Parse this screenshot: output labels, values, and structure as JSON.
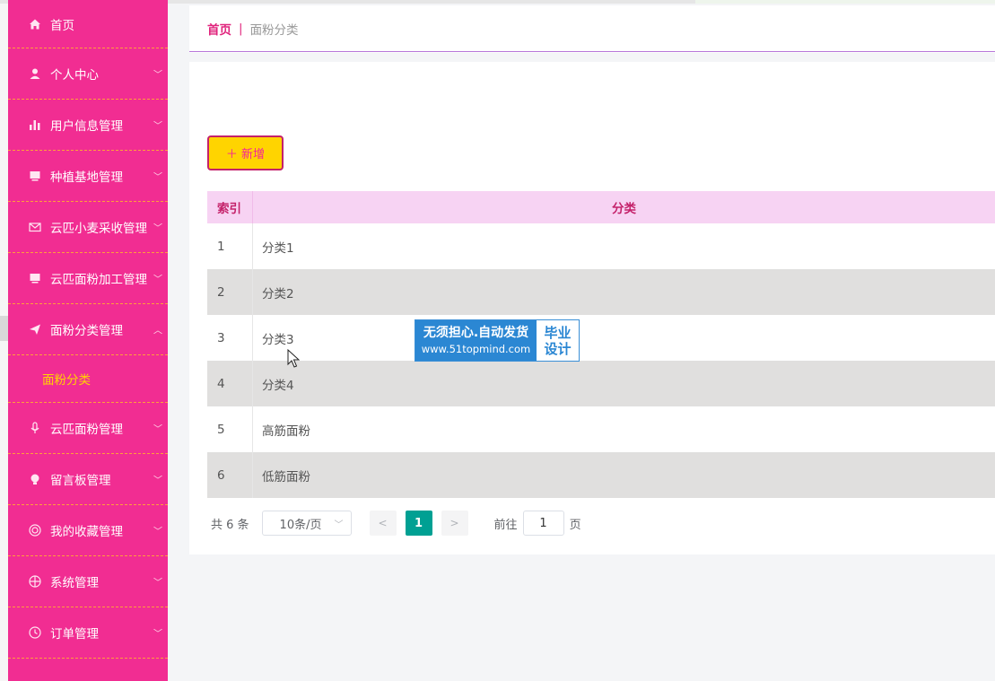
{
  "sidebar": {
    "items": [
      {
        "label": "首页",
        "icon": "home-icon",
        "has_arrow": false
      },
      {
        "label": "个人中心",
        "icon": "user-icon",
        "has_arrow": true
      },
      {
        "label": "用户信息管理",
        "icon": "bar-chart-icon",
        "has_arrow": true
      },
      {
        "label": "种植基地管理",
        "icon": "monitor-icon",
        "has_arrow": true
      },
      {
        "label": "云匹小麦采收管理",
        "icon": "mail-icon",
        "has_arrow": true
      },
      {
        "label": "云匹面粉加工管理",
        "icon": "monitor-icon",
        "has_arrow": true
      },
      {
        "label": "面粉分类管理",
        "icon": "send-icon",
        "has_arrow": true,
        "expanded": true
      },
      {
        "label": "云匹面粉管理",
        "icon": "microphone-icon",
        "has_arrow": true
      },
      {
        "label": "留言板管理",
        "icon": "bulb-icon",
        "has_arrow": true
      },
      {
        "label": "我的收藏管理",
        "icon": "target-icon",
        "has_arrow": true
      },
      {
        "label": "系统管理",
        "icon": "globe-icon",
        "has_arrow": true
      },
      {
        "label": "订单管理",
        "icon": "clock-icon",
        "has_arrow": true
      }
    ],
    "submenu": {
      "label": "面粉分类"
    }
  },
  "breadcrumb": {
    "home": "首页",
    "separator": "|",
    "current": "面粉分类"
  },
  "toolbar": {
    "add_label": "＋ 新增"
  },
  "table": {
    "headers": [
      "索引",
      "分类"
    ],
    "rows": [
      {
        "index": "1",
        "category": "分类1"
      },
      {
        "index": "2",
        "category": "分类2"
      },
      {
        "index": "3",
        "category": "分类3"
      },
      {
        "index": "4",
        "category": "分类4"
      },
      {
        "index": "5",
        "category": "高筋面粉"
      },
      {
        "index": "6",
        "category": "低筋面粉"
      }
    ]
  },
  "pagination": {
    "total": "共 6 条",
    "page_size": "10条/页",
    "prev": "<",
    "current_page": "1",
    "next": ">",
    "goto_label": "前往",
    "goto_value": "1",
    "page_suffix": "页"
  },
  "watermark": {
    "line1": "无须担心.自动发货",
    "line2": "www.51topmind.com",
    "right1": "毕业",
    "right2": "设计"
  },
  "colors": {
    "sidebar_bg": "#f12d92",
    "accent_yellow": "#ffd400",
    "header_bg": "#f7d3f3",
    "pager_active": "#00a093"
  }
}
